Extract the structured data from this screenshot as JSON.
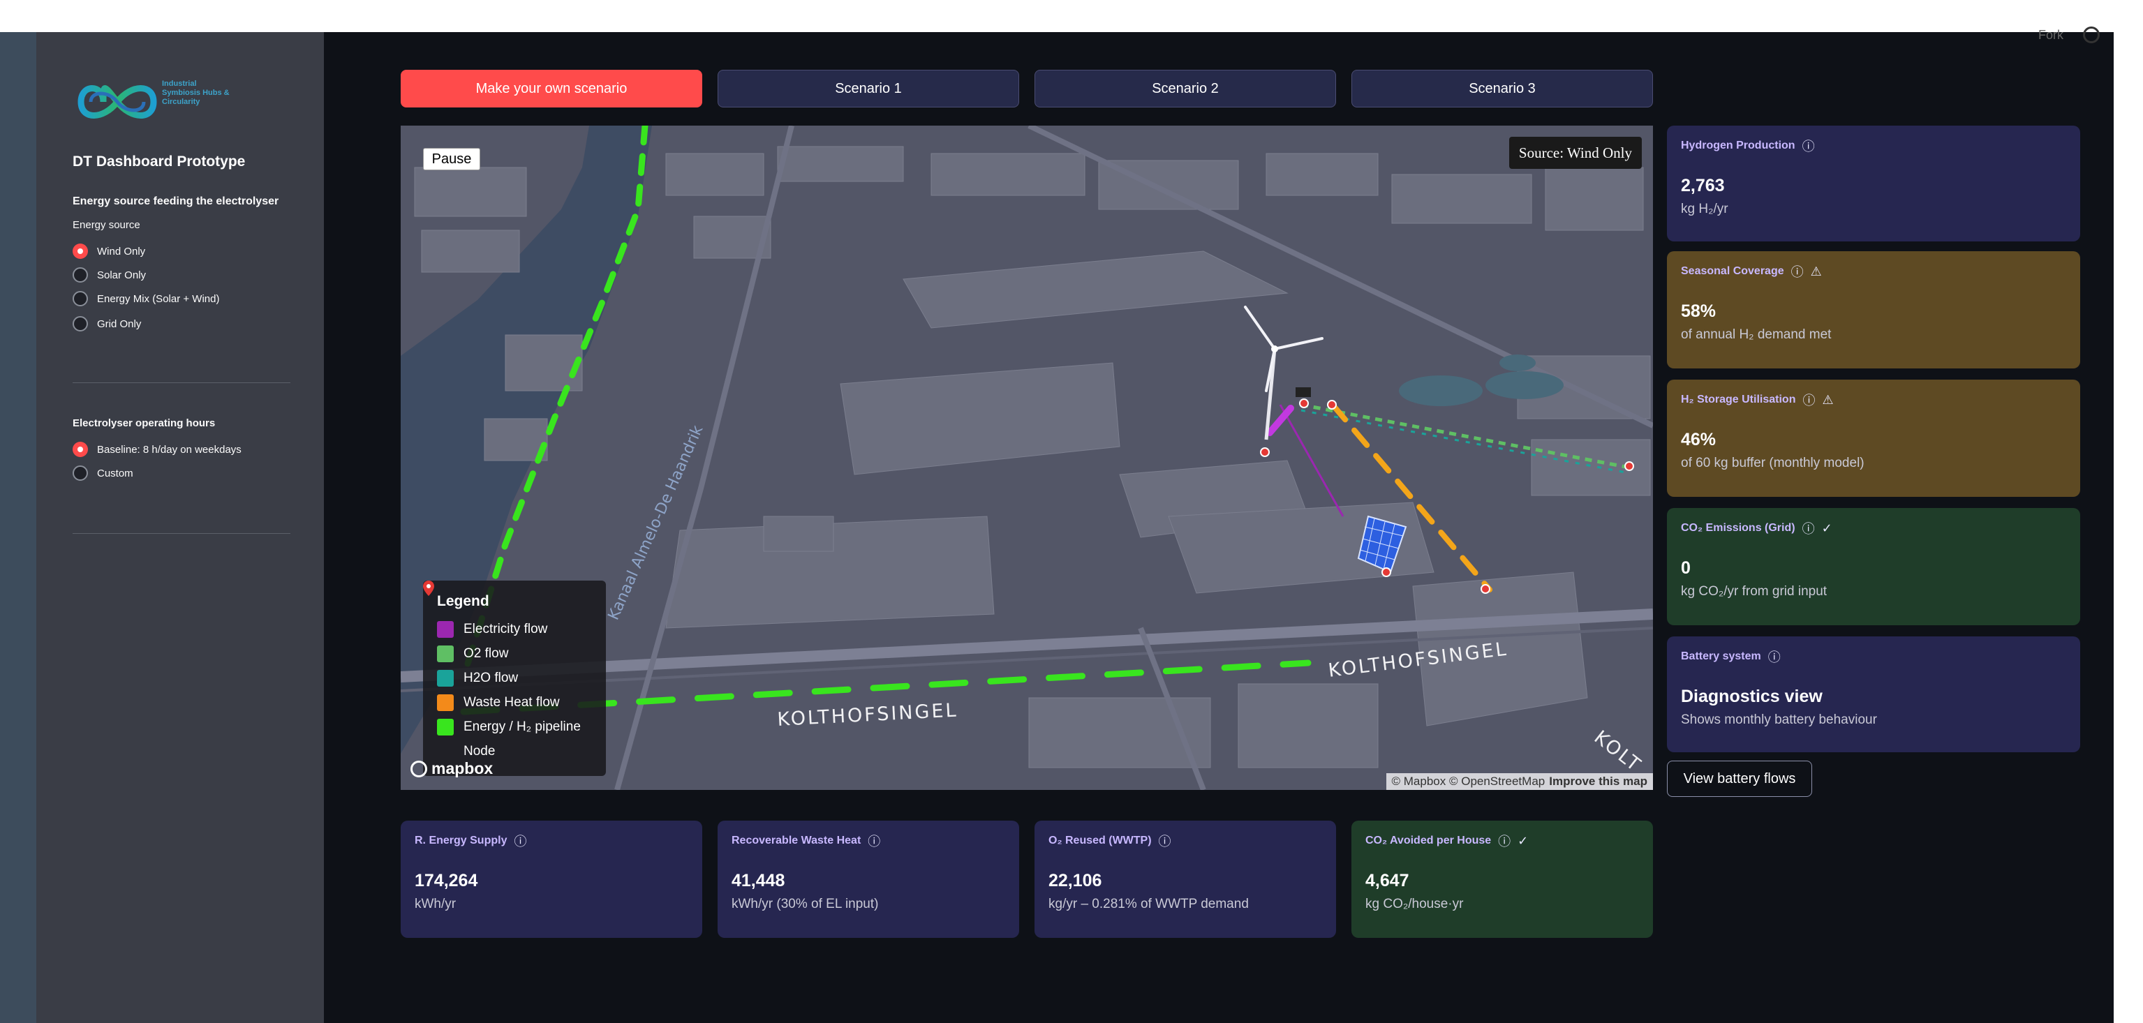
{
  "header": {
    "fork_label": "Fork"
  },
  "sidebar": {
    "logo_text": "Industrial Symbiosis Hubs & Circularity",
    "app_title": "DT Dashboard Prototype",
    "energy_section_title": "Energy source feeding the electrolyser",
    "energy_label": "Energy source",
    "energy_options": [
      {
        "label": "Wind Only",
        "selected": true
      },
      {
        "label": "Solar Only",
        "selected": false
      },
      {
        "label": "Energy Mix (Solar + Wind)",
        "selected": false
      },
      {
        "label": "Grid Only",
        "selected": false
      }
    ],
    "hours_label": "Electrolyser operating hours",
    "hours_options": [
      {
        "label": "Baseline: 8 h/day on weekdays",
        "selected": true
      },
      {
        "label": "Custom",
        "selected": false
      }
    ]
  },
  "tabs": [
    {
      "label": "Make your own scenario",
      "active": true
    },
    {
      "label": "Scenario 1",
      "active": false
    },
    {
      "label": "Scenario 2",
      "active": false
    },
    {
      "label": "Scenario 3",
      "active": false
    }
  ],
  "map": {
    "pause_label": "Pause",
    "source_label": "Source: Wind Only",
    "street_label": "KOLTHOFSINGEL",
    "street_label_cut": "KOLT",
    "canal_label": "Kanaal Almelo-De Haandrik",
    "legend_title": "Legend",
    "legend": [
      {
        "label": "Electricity flow",
        "color": "#9b27b0",
        "icon": "swatch"
      },
      {
        "label": "O2 flow",
        "color": "#5fbf64",
        "icon": "swatch"
      },
      {
        "label": "H2O flow",
        "color": "#1aa39a",
        "icon": "swatch"
      },
      {
        "label": "Waste Heat flow",
        "color": "#f38a1a",
        "icon": "swatch"
      },
      {
        "label": "Energy / H₂ pipeline",
        "color": "#39e51e",
        "icon": "swatch"
      },
      {
        "label": "Node",
        "color": "#e53935",
        "icon": "map-pin-icon"
      }
    ],
    "mapbox_label": "mapbox",
    "attribution": "© Mapbox © OpenStreetMap",
    "improve_label": "Improve this map"
  },
  "kpis_right": [
    {
      "title": "Hydrogen Production",
      "value": "2,763",
      "sub": "kg H₂/yr",
      "style": "blue",
      "warn": false,
      "check": false
    },
    {
      "title": "Seasonal Coverage",
      "value": "58%",
      "sub": "of annual H₂ demand met",
      "style": "brown",
      "warn": true,
      "check": false
    },
    {
      "title": "H₂ Storage Utilisation",
      "value": "46%",
      "sub": "of 60 kg buffer (monthly model)",
      "style": "brown",
      "warn": true,
      "check": false
    },
    {
      "title": "CO₂ Emissions (Grid)",
      "value": "0",
      "sub": "kg CO₂/yr from grid input",
      "style": "green",
      "warn": false,
      "check": true
    },
    {
      "title": "Battery system",
      "value": "Diagnostics view",
      "sub": "Shows monthly battery behaviour",
      "style": "blue",
      "warn": false,
      "check": false
    }
  ],
  "battery_button_label": "View battery flows",
  "kpis_bottom": [
    {
      "title": "R. Energy Supply",
      "value": "174,264",
      "sub": "kWh/yr",
      "style": "blue",
      "check": false
    },
    {
      "title": "Recoverable Waste Heat",
      "value": "41,448",
      "sub": "kWh/yr (30% of EL input)",
      "style": "blue",
      "check": false
    },
    {
      "title": "O₂ Reused (WWTP)",
      "value": "22,106",
      "sub": "kg/yr – 0.281% of WWTP demand",
      "style": "blue",
      "check": false
    },
    {
      "title": "CO₂ Avoided per House",
      "value": "4,647",
      "sub": "kg CO₂/house·yr",
      "style": "green",
      "check": true
    }
  ],
  "icons": {
    "info": "ⓘ",
    "warn": "⚠",
    "check": "✓"
  }
}
